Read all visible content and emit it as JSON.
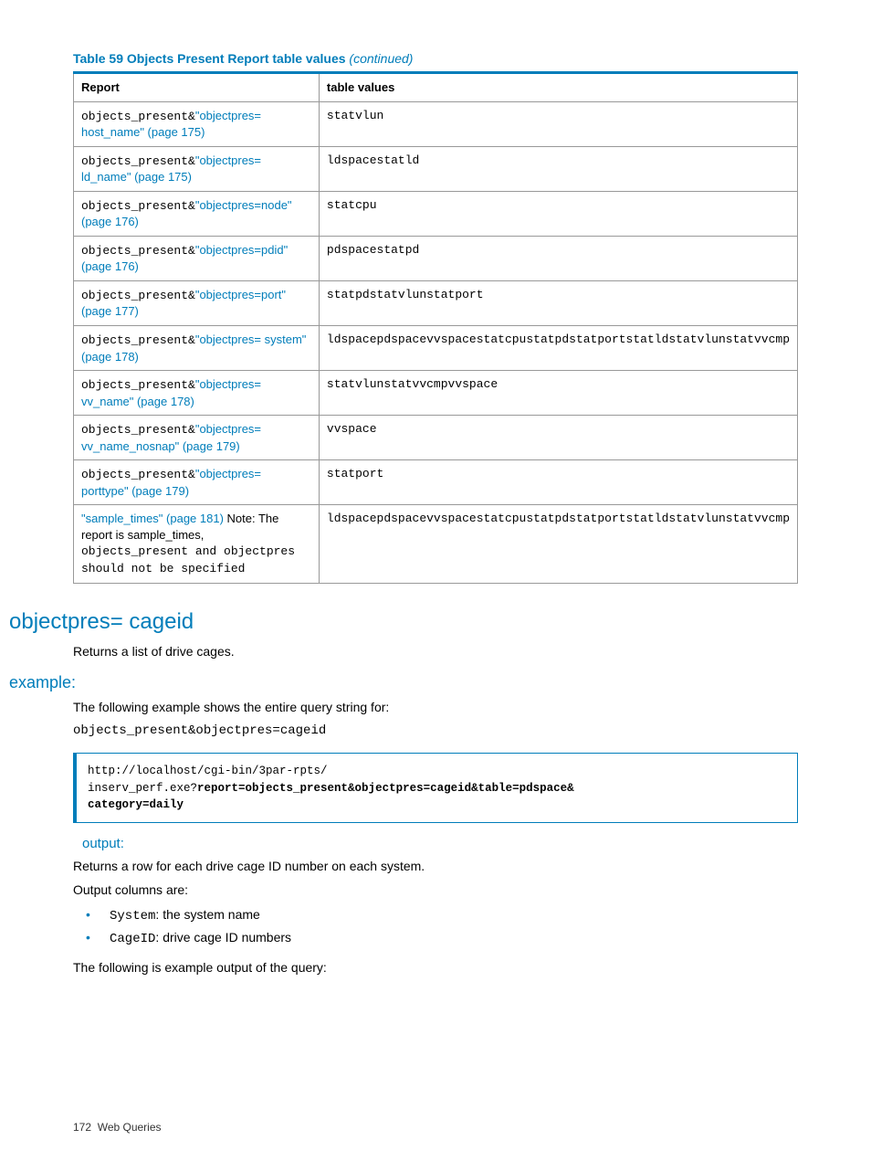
{
  "table_caption_main": "Table 59 Objects Present Report table values",
  "table_caption_cont": "(continued)",
  "table": {
    "headers": [
      "Report",
      "table values"
    ],
    "rows": [
      {
        "prefix": "objects_present&",
        "link_text": "\"objectpres= host_name\" (page 175)",
        "note": "",
        "value": "statvlun"
      },
      {
        "prefix": "objects_present&",
        "link_text": "\"objectpres= ld_name\" (page 175)",
        "note": "",
        "value": "ldspacestatld"
      },
      {
        "prefix": "objects_present&",
        "link_text": "\"objectpres=node\" (page 176)",
        "note": "",
        "value": "statcpu"
      },
      {
        "prefix": "objects_present&",
        "link_text": "\"objectpres=pdid\" (page 176)",
        "note": "",
        "value": "pdspacestatpd"
      },
      {
        "prefix": "objects_present&",
        "link_text": "\"objectpres=port\" (page 177)",
        "note": "",
        "value": "statpdstatvlunstatport"
      },
      {
        "prefix": "objects_present&",
        "link_text": "\"objectpres= system\" (page 178)",
        "note": "",
        "value": "ldspacepdspacevvspacestatcpustatpdstatportstatldstatvlunstatvvcmp"
      },
      {
        "prefix": "objects_present&",
        "link_text": "\"objectpres= vv_name\" (page 178)",
        "note": "",
        "value": "statvlunstatvvcmpvvspace"
      },
      {
        "prefix": "objects_present&",
        "link_text": "\"objectpres= vv_name_nosnap\" (page 179)",
        "note": "",
        "value": "vvspace"
      },
      {
        "prefix": "objects_present&",
        "link_text": "\"objectpres= porttype\" (page 179)",
        "note": "",
        "value": "statport"
      },
      {
        "prefix": "",
        "link_text": "\"sample_times\" (page 181)",
        "note_intro": " Note: The report is sample_times, ",
        "note_mono": "objects_present and objectpres should not be specified",
        "value": "ldspacepdspacevvspacestatcpustatpdstatportstatldstatvlunstatvvcmp"
      }
    ]
  },
  "h1": "objectpres= cageid",
  "h1_desc": "Returns a list of drive cages.",
  "example_heading": "example:",
  "example_intro": "The following example shows the entire query string for:",
  "example_query": "objects_present&objectpres=cageid",
  "codebox": {
    "line1": "http://localhost/cgi-bin/3par-rpts/",
    "line2_prefix": "inserv_perf.exe?",
    "line2_bold": "report=objects_present&objectpres=cageid&table=pdspace&",
    "line3_bold": "category=daily"
  },
  "output_heading": "output:",
  "output_p1": "Returns a row for each drive cage ID number on each system.",
  "output_p2": "Output columns are:",
  "bullets": [
    {
      "code": "System",
      "desc": ": the system name"
    },
    {
      "code": "CageID",
      "desc": ": drive cage ID numbers"
    }
  ],
  "output_p3": "The following is example output of the query:",
  "footer_page": "172",
  "footer_title": "Web Queries"
}
